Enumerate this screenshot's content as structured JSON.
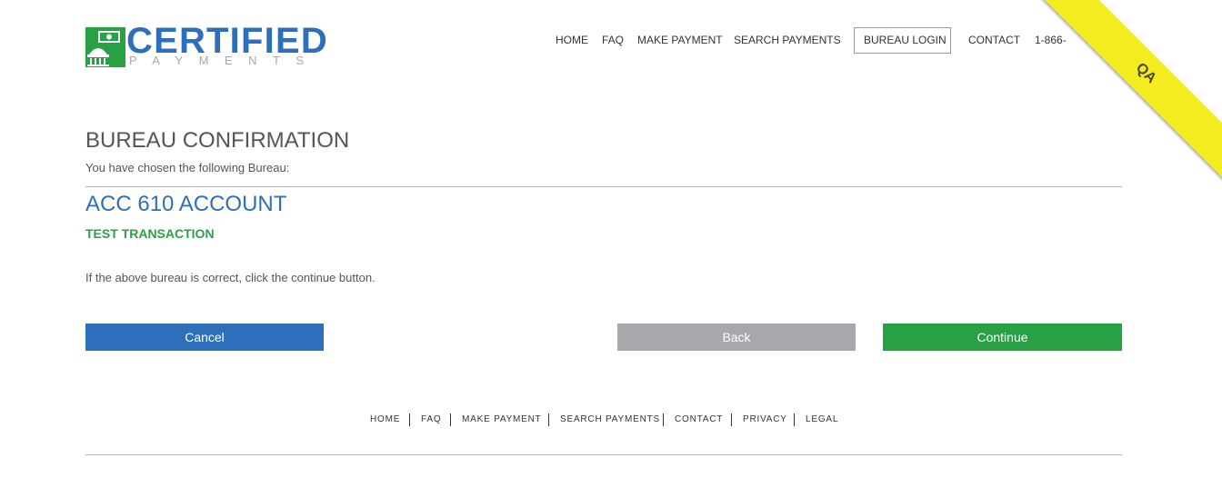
{
  "logo": {
    "name": "CERTIFIED",
    "tagline": "PAYMENTS"
  },
  "nav": {
    "items": [
      {
        "label": "HOME"
      },
      {
        "label": "FAQ"
      },
      {
        "label": "MAKE PAYMENT"
      },
      {
        "label": "SEARCH PAYMENTS"
      },
      {
        "label": "BUREAU LOGIN"
      },
      {
        "label": "CONTACT"
      },
      {
        "label": "1-866-"
      }
    ]
  },
  "environment_ribbon": {
    "label": "QA",
    "color": "#f5ec1f"
  },
  "main": {
    "title": "BUREAU CONFIRMATION",
    "subtitle": "You have chosen the following Bureau:",
    "bureau_name": "ACC 610 ACCOUNT",
    "bureau_detail": "TEST TRANSACTION",
    "instruction": "If the above bureau is correct, click the continue button."
  },
  "buttons": {
    "cancel": "Cancel",
    "back": "Back",
    "continue": "Continue"
  },
  "footer": {
    "items": [
      {
        "label": "HOME"
      },
      {
        "label": "FAQ"
      },
      {
        "label": "MAKE PAYMENT"
      },
      {
        "label": "SEARCH PAYMENTS"
      },
      {
        "label": "CONTACT"
      },
      {
        "label": "PRIVACY"
      },
      {
        "label": "LEGAL"
      }
    ]
  },
  "colors": {
    "brand_blue": "#2d6fba",
    "brand_green": "#28a145",
    "back_gray": "#a7a8ab"
  }
}
